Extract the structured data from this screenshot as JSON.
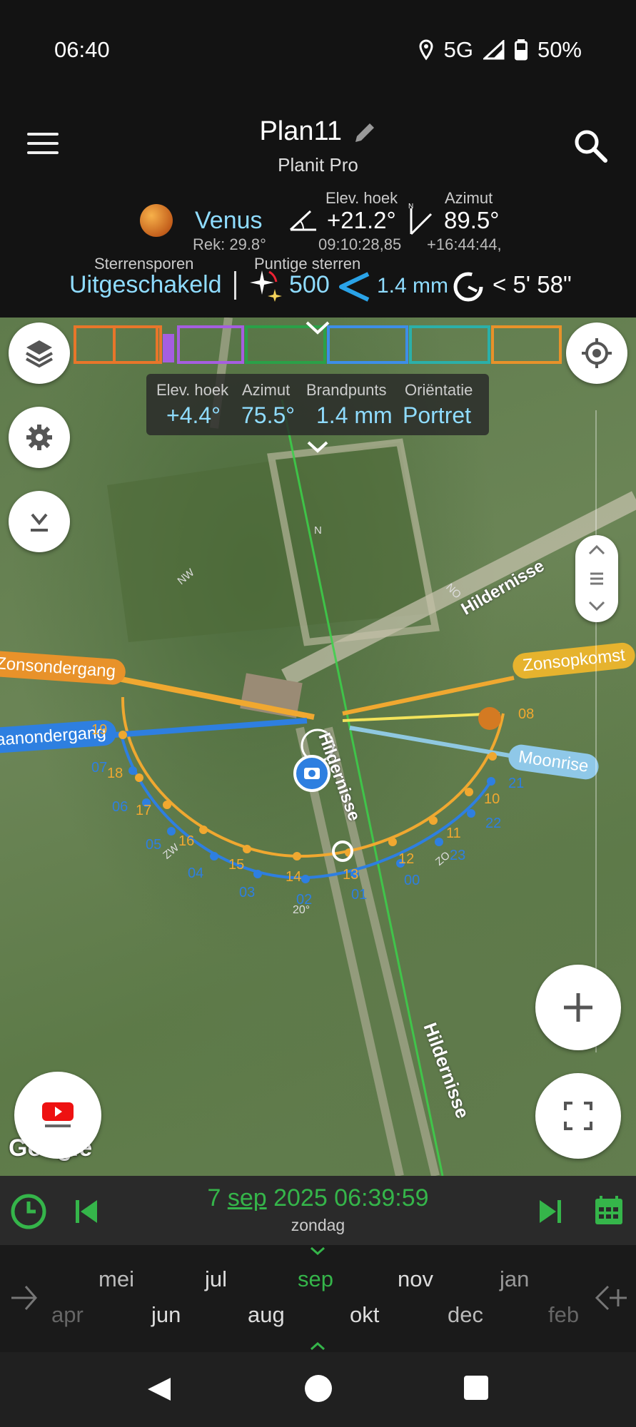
{
  "status": {
    "time": "06:40",
    "network": "5G",
    "battery": "50%"
  },
  "header": {
    "title": "Plan11",
    "subtitle": "Planit Pro"
  },
  "planet": {
    "name": "Venus",
    "rek": "Rek: 29.8°",
    "elev_label": "Elev. hoek",
    "elev_value": "+21.2°",
    "elev_time": "09:10:28,85",
    "azimut_label": "Azimut",
    "azimut_value": "89.5°",
    "azimut_time": "+16:44:44,"
  },
  "stars": {
    "trails_label": "Sterrensporen",
    "trails_value": "Uitgeschakeld",
    "point_label": "Puntige sterren",
    "point_value": "500",
    "focal": "1.4 mm",
    "exposure": "< 5' 58\""
  },
  "infobox": {
    "elev_label": "Elev. hoek",
    "elev_value": "+4.4°",
    "az_label": "Azimut",
    "az_value": "75.5°",
    "focal_label": "Brandpunts",
    "focal_value": "1.4 mm",
    "orient_label": "Oriëntatie",
    "orient_value": "Portret"
  },
  "map": {
    "road_1": "Hildernisse",
    "road_2": "Hildernisse",
    "road_3": "Hildernisse",
    "sunset": "Zonsondergang",
    "sunrise": "Zonsopkomst",
    "moonset": "Maanondergang",
    "moonrise": "Moonrise",
    "google": "Google",
    "compass_nw": "NW",
    "compass_no": "NO",
    "compass_zw": "ZW",
    "compass_zo": "ZO",
    "compass_n": "N",
    "angle": "20°",
    "sun_hours": [
      "19",
      "18",
      "17",
      "16",
      "15",
      "14",
      "13",
      "12",
      "11",
      "10",
      "08"
    ],
    "moon_hours": [
      "07",
      "06",
      "05",
      "04",
      "03",
      "02",
      "01",
      "00",
      "23",
      "22",
      "21"
    ]
  },
  "bottom": {
    "date_pre": "7 ",
    "date_month": "sep",
    "date_post": " 2025 06:39:59",
    "weekday": "zondag"
  },
  "months_top": [
    "mei",
    "jul",
    "sep",
    "nov",
    "jan"
  ],
  "months_bottom": [
    "apr",
    "jun",
    "aug",
    "okt",
    "dec",
    "feb"
  ],
  "colors": {
    "accent_green": "#35b54a",
    "sun": "#f0a830",
    "moon": "#2e7fe0",
    "cyan": "#8fdcff"
  }
}
